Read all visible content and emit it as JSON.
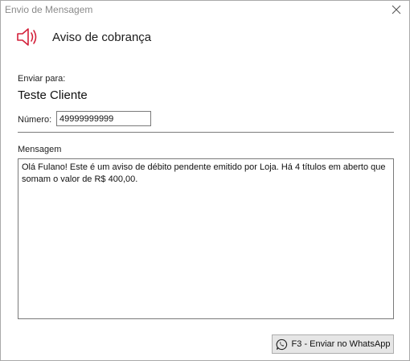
{
  "window": {
    "title": "Envio de Mensagem"
  },
  "header": {
    "title": "Aviso de cobrança",
    "icon": "speaker-icon",
    "icon_color": "#d3203a"
  },
  "form": {
    "enviar_label": "Enviar para:",
    "cliente": "Teste Cliente",
    "numero_label": "Número:",
    "numero_value": "49999999999",
    "mensagem_label": "Mensagem",
    "mensagem_value": "Olá Fulano! Este é um aviso de débito pendente emitido por Loja. Há 4 títulos em aberto que somam o valor de R$ 400,00."
  },
  "actions": {
    "send_whatsapp_label": "F3 - Enviar no WhatsApp",
    "send_whatsapp_icon": "whatsapp-icon"
  }
}
